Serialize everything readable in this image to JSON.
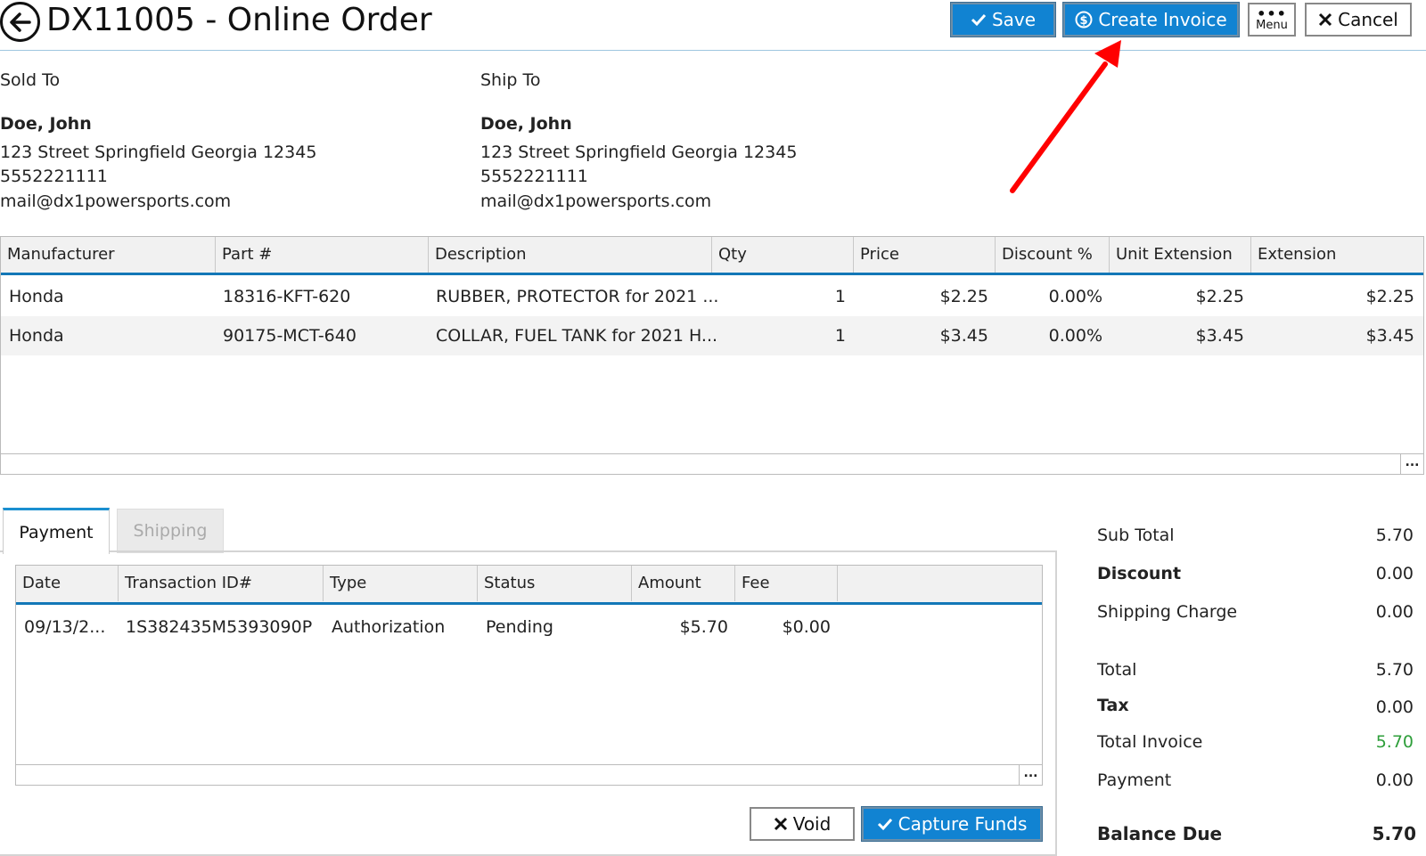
{
  "header": {
    "title": "DX11005 - Online Order",
    "save_label": "Save",
    "create_invoice_label": "Create Invoice",
    "menu_label": "Menu",
    "cancel_label": "Cancel"
  },
  "sold_to": {
    "label": "Sold To",
    "name": "Doe, John",
    "address": "123 Street Springfield Georgia 12345",
    "phone": "5552221111",
    "email": "mail@dx1powersports.com"
  },
  "ship_to": {
    "label": "Ship To",
    "name": "Doe, John",
    "address": "123 Street Springfield Georgia 12345",
    "phone": "5552221111",
    "email": "mail@dx1powersports.com"
  },
  "items": {
    "columns": [
      "Manufacturer",
      "Part #",
      "Description",
      "Qty",
      "Price",
      "Discount %",
      "Unit Extension",
      "Extension"
    ],
    "rows": [
      [
        "Honda",
        "18316-KFT-620",
        "RUBBER, PROTECTOR for 2021 ...",
        "1",
        "$2.25",
        "0.00%",
        "$2.25",
        "$2.25"
      ],
      [
        "Honda",
        "90175-MCT-640",
        "COLLAR, FUEL TANK for 2021 H...",
        "1",
        "$3.45",
        "0.00%",
        "$3.45",
        "$3.45"
      ]
    ],
    "more_label": "..."
  },
  "tabs": {
    "payment": "Payment",
    "shipping": "Shipping"
  },
  "payments": {
    "columns": [
      "Date",
      "Transaction ID#",
      "Type",
      "Status",
      "Amount",
      "Fee"
    ],
    "rows": [
      [
        "09/13/2...",
        "1S382435M5393090P",
        "Authorization",
        "Pending",
        "$5.70",
        "$0.00"
      ]
    ],
    "more_label": "...",
    "void_label": "Void",
    "capture_label": "Capture Funds"
  },
  "totals": {
    "sub_total_label": "Sub Total",
    "sub_total": "5.70",
    "discount_label": "Discount",
    "discount": "0.00",
    "shipping_label": "Shipping Charge",
    "shipping": "0.00",
    "total_label": "Total",
    "total": "5.70",
    "tax_label": "Tax",
    "tax": "0.00",
    "total_invoice_label": "Total Invoice",
    "total_invoice": "5.70",
    "payment_label": "Payment",
    "payment": "0.00",
    "balance_due_label": "Balance Due",
    "balance_due": "5.70"
  },
  "colors": {
    "primary": "#1183d2",
    "header_rule": "#1377b7",
    "annotation_arrow": "#ff0000",
    "total_invoice_value": "#2e9e3a"
  }
}
